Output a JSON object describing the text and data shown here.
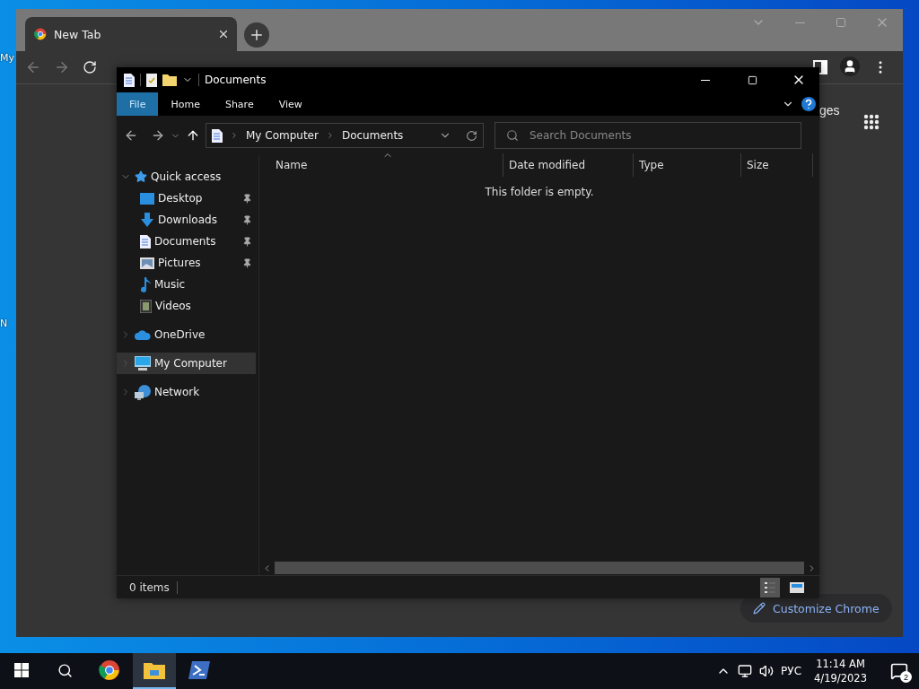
{
  "desktop": {
    "icon_labels": [
      "My",
      "N"
    ]
  },
  "browser": {
    "tab": {
      "title": "New Tab"
    },
    "side_text": "ges",
    "customize_button": "Customize Chrome"
  },
  "explorer": {
    "title": "Documents",
    "ribbon_tabs": [
      {
        "label": "File",
        "selected": true
      },
      {
        "label": "Home",
        "selected": false
      },
      {
        "label": "Share",
        "selected": false
      },
      {
        "label": "View",
        "selected": false
      }
    ],
    "breadcrumb": [
      "My Computer",
      "Documents"
    ],
    "search": {
      "placeholder": "Search Documents"
    },
    "columns": [
      "Name",
      "Date modified",
      "Type",
      "Size"
    ],
    "empty_message": "This folder is empty.",
    "nav": [
      {
        "label": "Quick access",
        "kind": "star",
        "expanded": true,
        "selected": false,
        "children": [
          {
            "label": "Desktop",
            "kind": "desktop",
            "pinned": true,
            "selected": false
          },
          {
            "label": "Downloads",
            "kind": "download",
            "pinned": true,
            "selected": false
          },
          {
            "label": "Documents",
            "kind": "document",
            "pinned": true,
            "selected": false
          },
          {
            "label": "Pictures",
            "kind": "pictures",
            "pinned": true,
            "selected": false
          },
          {
            "label": "Music",
            "kind": "music",
            "pinned": false,
            "selected": false
          },
          {
            "label": "Videos",
            "kind": "videos",
            "pinned": false,
            "selected": false
          }
        ]
      },
      {
        "label": "OneDrive",
        "kind": "cloud",
        "expanded": false,
        "selected": false
      },
      {
        "label": "My Computer",
        "kind": "computer",
        "expanded": false,
        "selected": true
      },
      {
        "label": "Network",
        "kind": "network",
        "expanded": false,
        "selected": false
      }
    ],
    "status": "0 items",
    "views": [
      {
        "kind": "details",
        "selected": true
      },
      {
        "kind": "tiles",
        "selected": false
      }
    ]
  },
  "taskbar": {
    "apps": [
      {
        "kind": "chrome",
        "active": false
      },
      {
        "kind": "explorer",
        "active": true
      },
      {
        "kind": "powershell",
        "active": false
      }
    ],
    "language": "РУС",
    "time": "11:14 AM",
    "date": "4/19/2023",
    "notifications": "2"
  }
}
